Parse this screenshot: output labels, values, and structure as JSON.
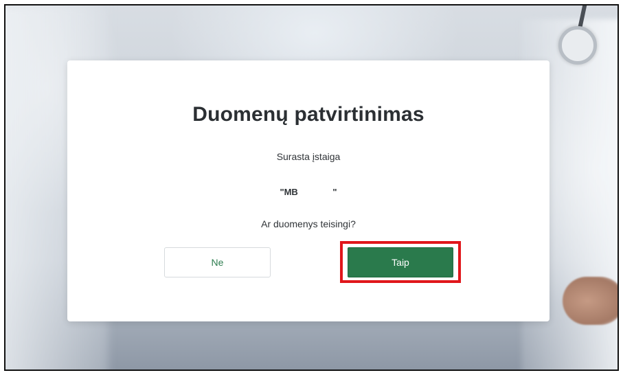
{
  "dialog": {
    "title": "Duomenų patvirtinimas",
    "found_label": "Surasta įstaiga",
    "institution_name": "\"MB              \"",
    "question": "Ar duomenys teisingi?"
  },
  "buttons": {
    "no_label": "Ne",
    "yes_label": "Taip"
  },
  "colors": {
    "primary_green": "#2a7a4c",
    "highlight_red": "#e0161b",
    "title_text": "#2b2f33"
  }
}
